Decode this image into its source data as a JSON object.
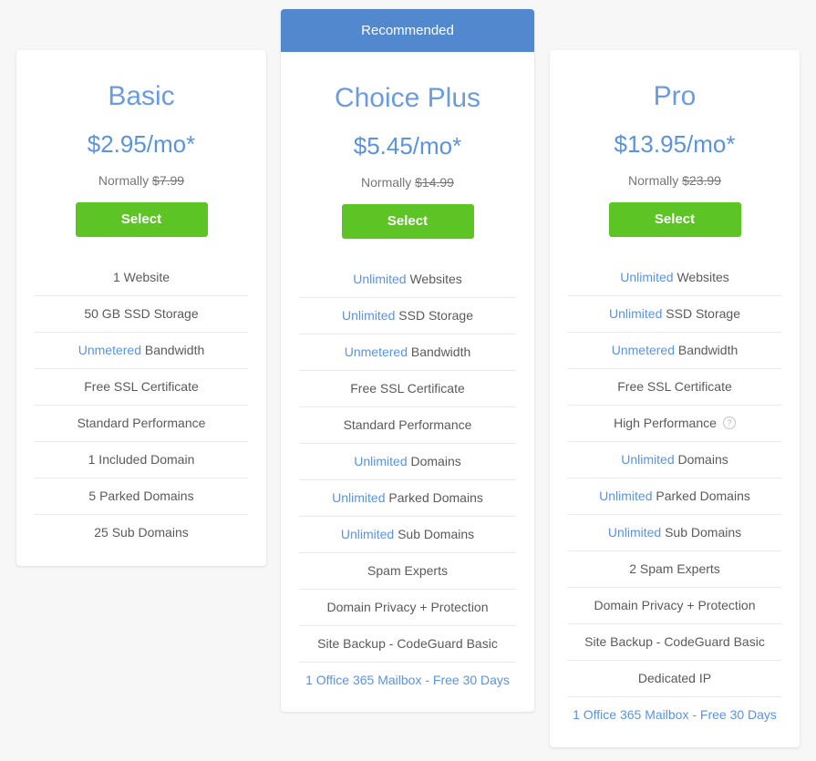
{
  "colors": {
    "page_background": "#f7f7f7",
    "card_background": "#ffffff",
    "banner_blue": "#5289ce",
    "title_blue": "#6c9be0",
    "price_blue": "#5c93dd",
    "highlight_blue": "#5c93dd",
    "button_green": "#5dc425",
    "body_text": "#5a5a5a",
    "muted_text": "#767676",
    "divider": "#e9e9e9"
  },
  "plans": [
    {
      "id": "basic",
      "name": "Basic",
      "price": "$2.95/mo*",
      "normally_label": "Normally",
      "normally_price": "$7.99",
      "select_label": "Select",
      "badge": null,
      "features": [
        {
          "highlight": "",
          "text": "1 Website",
          "link": false,
          "help": false
        },
        {
          "highlight": "",
          "text": "50 GB SSD Storage",
          "link": false,
          "help": false
        },
        {
          "highlight": "Unmetered",
          "text": "Bandwidth",
          "link": false,
          "help": false
        },
        {
          "highlight": "",
          "text": "Free SSL Certificate",
          "link": false,
          "help": false
        },
        {
          "highlight": "",
          "text": "Standard Performance",
          "link": false,
          "help": false
        },
        {
          "highlight": "",
          "text": "1 Included Domain",
          "link": false,
          "help": false
        },
        {
          "highlight": "",
          "text": "5 Parked Domains",
          "link": false,
          "help": false
        },
        {
          "highlight": "",
          "text": "25 Sub Domains",
          "link": false,
          "help": false
        }
      ]
    },
    {
      "id": "choice-plus",
      "name": "Choice Plus",
      "price": "$5.45/mo*",
      "normally_label": "Normally",
      "normally_price": "$14.99",
      "select_label": "Select",
      "badge": "Recommended",
      "features": [
        {
          "highlight": "Unlimited",
          "text": "Websites",
          "link": false,
          "help": false
        },
        {
          "highlight": "Unlimited",
          "text": "SSD Storage",
          "link": false,
          "help": false
        },
        {
          "highlight": "Unmetered",
          "text": "Bandwidth",
          "link": false,
          "help": false
        },
        {
          "highlight": "",
          "text": "Free SSL Certificate",
          "link": false,
          "help": false
        },
        {
          "highlight": "",
          "text": "Standard Performance",
          "link": false,
          "help": false
        },
        {
          "highlight": "Unlimited",
          "text": "Domains",
          "link": false,
          "help": false
        },
        {
          "highlight": "Unlimited",
          "text": "Parked Domains",
          "link": false,
          "help": false
        },
        {
          "highlight": "Unlimited",
          "text": "Sub Domains",
          "link": false,
          "help": false
        },
        {
          "highlight": "",
          "text": "Spam Experts",
          "link": false,
          "help": false
        },
        {
          "highlight": "",
          "text": "Domain Privacy + Protection",
          "link": false,
          "help": false
        },
        {
          "highlight": "",
          "text": "Site Backup - CodeGuard Basic",
          "link": false,
          "help": false
        },
        {
          "highlight": "",
          "text": "1 Office 365 Mailbox - Free 30 Days",
          "link": true,
          "help": false
        }
      ]
    },
    {
      "id": "pro",
      "name": "Pro",
      "price": "$13.95/mo*",
      "normally_label": "Normally",
      "normally_price": "$23.99",
      "select_label": "Select",
      "badge": null,
      "features": [
        {
          "highlight": "Unlimited",
          "text": "Websites",
          "link": false,
          "help": false
        },
        {
          "highlight": "Unlimited",
          "text": "SSD Storage",
          "link": false,
          "help": false
        },
        {
          "highlight": "Unmetered",
          "text": "Bandwidth",
          "link": false,
          "help": false
        },
        {
          "highlight": "",
          "text": "Free SSL Certificate",
          "link": false,
          "help": false
        },
        {
          "highlight": "",
          "text": "High Performance",
          "link": false,
          "help": true
        },
        {
          "highlight": "Unlimited",
          "text": "Domains",
          "link": false,
          "help": false
        },
        {
          "highlight": "Unlimited",
          "text": "Parked Domains",
          "link": false,
          "help": false
        },
        {
          "highlight": "Unlimited",
          "text": "Sub Domains",
          "link": false,
          "help": false
        },
        {
          "highlight": "",
          "text": "2 Spam Experts",
          "link": false,
          "help": false
        },
        {
          "highlight": "",
          "text": "Domain Privacy + Protection",
          "link": false,
          "help": false
        },
        {
          "highlight": "",
          "text": "Site Backup - CodeGuard Basic",
          "link": false,
          "help": false
        },
        {
          "highlight": "",
          "text": "Dedicated IP",
          "link": false,
          "help": false
        },
        {
          "highlight": "",
          "text": "1 Office 365 Mailbox - Free 30 Days",
          "link": true,
          "help": false
        }
      ]
    }
  ],
  "icons": {
    "help": "?"
  }
}
